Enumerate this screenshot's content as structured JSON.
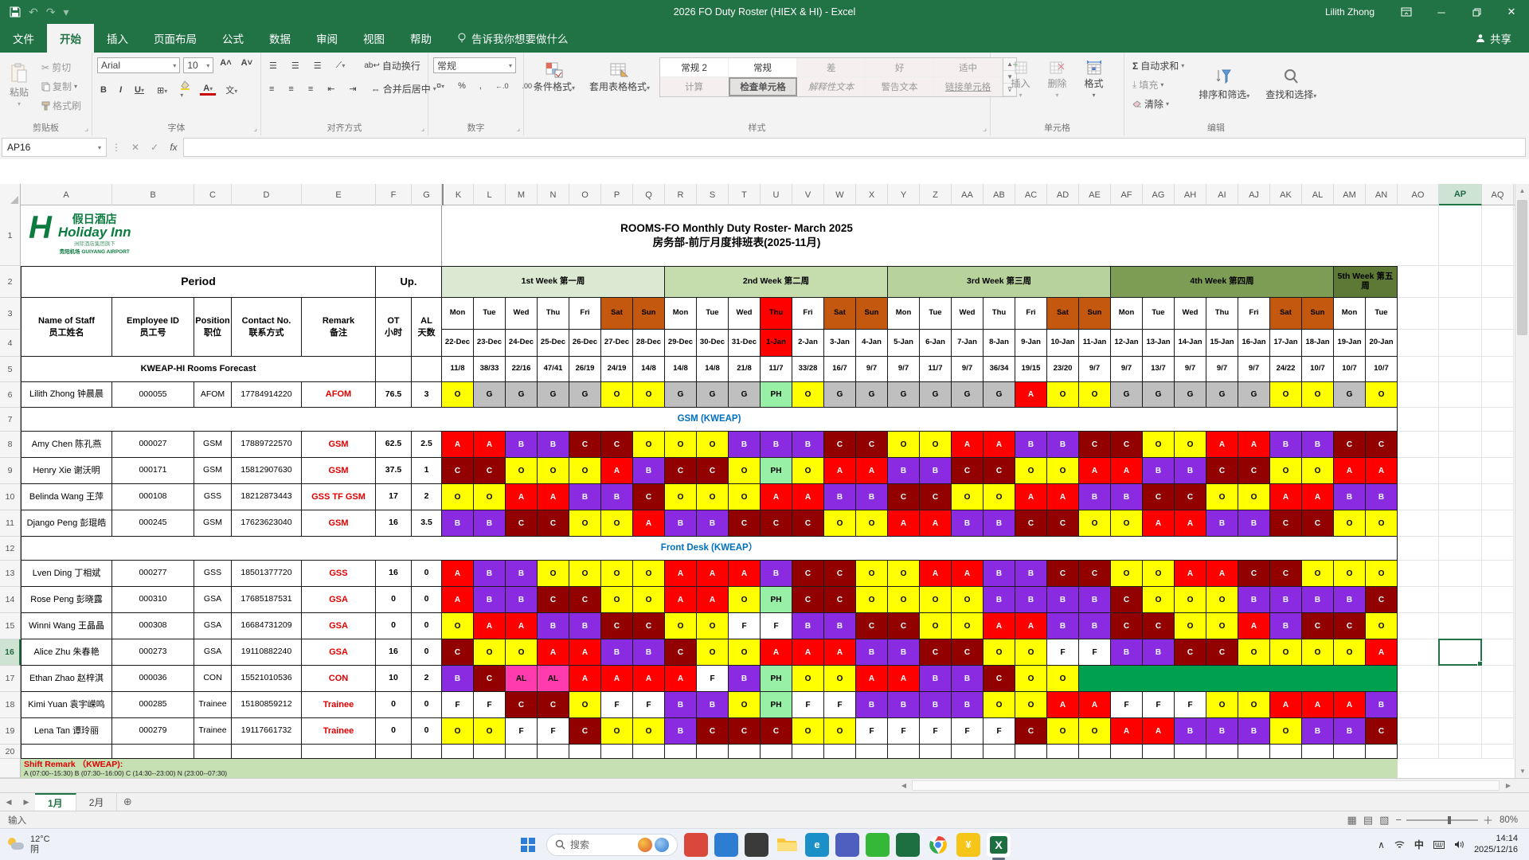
{
  "titlebar": {
    "title": "2026 FO Duty Roster (HIEX & HI)  -  Excel",
    "user": "Lilith Zhong"
  },
  "menu": {
    "tabs": [
      "文件",
      "开始",
      "插入",
      "页面布局",
      "公式",
      "数据",
      "审阅",
      "视图",
      "帮助"
    ],
    "active_tab": "开始",
    "tellme": "告诉我你想要做什么",
    "share": "共享"
  },
  "ribbon": {
    "clipboard": {
      "paste": "粘贴",
      "cut": "剪切",
      "copy": "复制",
      "painter": "格式刷",
      "label": "剪贴板"
    },
    "font": {
      "family": "Arial",
      "size": "10",
      "label": "字体",
      "pinyin": "文"
    },
    "align": {
      "wrap": "自动换行",
      "merge": "合并后居中",
      "label": "对齐方式"
    },
    "number": {
      "format": "常规",
      "label": "数字"
    },
    "styles": {
      "cond": "条件格式",
      "table": "套用表格格式",
      "label": "样式",
      "gallery": [
        "常规 2",
        "常规",
        "差",
        "好",
        "适中",
        "计算",
        "检查单元格",
        "解释性文本",
        "警告文本",
        "链接单元格"
      ],
      "selected_style": "检查单元格"
    },
    "cells": {
      "insert": "插入",
      "delete": "删除",
      "format": "格式",
      "label": "单元格"
    },
    "editing": {
      "autosum": "自动求和",
      "fill": "填充",
      "clear": "清除",
      "sort": "排序和筛选",
      "find": "查找和选择",
      "label": "编辑"
    }
  },
  "formula_bar": {
    "name_box": "AP16",
    "fx": "fx"
  },
  "sheet": {
    "col_headers": [
      "A",
      "B",
      "C",
      "D",
      "E",
      "F",
      "G",
      "K",
      "L",
      "M",
      "N",
      "O",
      "P",
      "Q",
      "R",
      "S",
      "T",
      "U",
      "V",
      "W",
      "X",
      "Y",
      "Z",
      "AA",
      "AB",
      "AC",
      "AD",
      "AE",
      "AF",
      "AG",
      "AH",
      "AI",
      "AJ",
      "AK",
      "AL",
      "AM",
      "AN",
      "AO",
      "AP",
      "AQ"
    ],
    "selected_col": "AP",
    "selected_row": 16,
    "logo": {
      "cn": "假日酒店",
      "en": "Holiday Inn",
      "sub1": "洲际酒店集团旗下",
      "sub2": "贵阳机场 GUIYANG AIRPORT"
    },
    "title1": "ROOMS-FO Monthly Duty Roster- March 2025",
    "title2": "房务部-前厅月度排班表(2025-11月)",
    "period": "Period",
    "up": "Up.",
    "left_headers": [
      [
        "Name of Staff",
        "员工姓名"
      ],
      [
        "Employee ID",
        "员工号"
      ],
      [
        "Position",
        "职位"
      ],
      [
        "Contact No.",
        "联系方式"
      ],
      [
        "Remark",
        "备注"
      ]
    ],
    "ot": [
      "OT",
      "小时"
    ],
    "al": [
      "AL",
      "天数"
    ],
    "weeks": [
      {
        "label": "1st Week 第一周",
        "days": 7,
        "color": "#dce9d2"
      },
      {
        "label": "2nd Week 第二周",
        "days": 7,
        "color": "#c5dcad"
      },
      {
        "label": "3rd Week 第三周",
        "days": 7,
        "color": "#b7d29b"
      },
      {
        "label": "4th Week 第四周",
        "days": 7,
        "color": "#7d9d54"
      },
      {
        "label": "5th Week 第五周",
        "days": 2,
        "color": "#5d7935"
      }
    ],
    "days": [
      "Mon",
      "Tue",
      "Wed",
      "Thu",
      "Fri",
      "Sat",
      "Sun",
      "Mon",
      "Tue",
      "Wed",
      "Thu",
      "Fri",
      "Sat",
      "Sun",
      "Mon",
      "Tue",
      "Wed",
      "Thu",
      "Fri",
      "Sat",
      "Sun",
      "Mon",
      "Tue",
      "Wed",
      "Thu",
      "Fri",
      "Sat",
      "Sun",
      "Mon",
      "Tue"
    ],
    "weekend_idx": [
      5,
      6,
      12,
      13,
      19,
      20,
      26,
      27
    ],
    "holiday_idx": 10,
    "dates": [
      "22-Dec",
      "23-Dec",
      "24-Dec",
      "25-Dec",
      "26-Dec",
      "27-Dec",
      "28-Dec",
      "29-Dec",
      "30-Dec",
      "31-Dec",
      "1-Jan",
      "2-Jan",
      "3-Jan",
      "4-Jan",
      "5-Jan",
      "6-Jan",
      "7-Jan",
      "8-Jan",
      "9-Jan",
      "10-Jan",
      "11-Jan",
      "12-Jan",
      "13-Jan",
      "14-Jan",
      "15-Jan",
      "16-Jan",
      "17-Jan",
      "18-Jan",
      "19-Jan",
      "20-Jan"
    ],
    "forecast_label": "KWEAP-HI Rooms Forecast",
    "forecast": [
      "11/8",
      "38/33",
      "22/16",
      "47/41",
      "26/19",
      "24/19",
      "14/8",
      "14/8",
      "14/8",
      "21/8",
      "11/7",
      "33/28",
      "16/7",
      "9/7",
      "9/7",
      "11/7",
      "9/7",
      "36/34",
      "19/15",
      "23/20",
      "9/7",
      "9/7",
      "13/7",
      "9/7",
      "9/7",
      "9/7",
      "24/22",
      "10/7",
      "10/7",
      "10/7"
    ],
    "group1": "GSM (KWEAP)",
    "group2": "Front Desk (KWEAP）",
    "staff": [
      {
        "row": 6,
        "name": "Lilith Zhong 钟晨晨",
        "id": "000055",
        "position": "AFOM",
        "contact": "17784914220",
        "remark": "AFOM",
        "ot": "76.5",
        "al": "3",
        "shifts": [
          "O",
          "G",
          "G",
          "G",
          "G",
          "O",
          "O",
          "G",
          "G",
          "G",
          "PH",
          "O",
          "G",
          "G",
          "G",
          "G",
          "G",
          "G",
          "A",
          "O",
          "O",
          "G",
          "G",
          "G",
          "G",
          "G",
          "O",
          "O",
          "G",
          "O"
        ]
      },
      {
        "row": 8,
        "name": "Amy Chen 陈孔燕",
        "id": "000027",
        "position": "GSM",
        "contact": "17889722570",
        "remark": "GSM",
        "ot": "62.5",
        "al": "2.5",
        "shifts": [
          "A",
          "A",
          "B",
          "B",
          "C",
          "C",
          "O",
          "O",
          "O",
          "B",
          "B",
          "B",
          "C",
          "C",
          "O",
          "O",
          "A",
          "A",
          "B",
          "B",
          "C",
          "C",
          "O",
          "O",
          "A",
          "A",
          "B",
          "B",
          "C",
          "C"
        ]
      },
      {
        "row": 9,
        "name": "Henry Xie 谢沃明",
        "id": "000171",
        "position": "GSM",
        "contact": "15812907630",
        "remark": "GSM",
        "ot": "37.5",
        "al": "1",
        "shifts": [
          "C",
          "C",
          "O",
          "O",
          "O",
          "A",
          "B",
          "C",
          "C",
          "O",
          "PH",
          "O",
          "A",
          "A",
          "B",
          "B",
          "C",
          "C",
          "O",
          "O",
          "A",
          "A",
          "B",
          "B",
          "C",
          "C",
          "O",
          "O",
          "A",
          "A"
        ]
      },
      {
        "row": 10,
        "name": "Belinda Wang 王萍",
        "id": "000108",
        "position": "GSS",
        "contact": "18212873443",
        "remark": "GSS TF GSM",
        "ot": "17",
        "al": "2",
        "shifts": [
          "O",
          "O",
          "A",
          "A",
          "B",
          "B",
          "C",
          "O",
          "O",
          "O",
          "A",
          "A",
          "B",
          "B",
          "C",
          "C",
          "O",
          "O",
          "A",
          "A",
          "B",
          "B",
          "C",
          "C",
          "O",
          "O",
          "A",
          "A",
          "B",
          "B"
        ]
      },
      {
        "row": 11,
        "name": "Django Peng 彭琨皓",
        "id": "000245",
        "position": "GSM",
        "contact": "17623623040",
        "remark": "GSM",
        "ot": "16",
        "al": "3.5",
        "shifts": [
          "B",
          "B",
          "C",
          "C",
          "O",
          "O",
          "A",
          "B",
          "B",
          "C",
          "C",
          "C",
          "O",
          "O",
          "A",
          "A",
          "B",
          "B",
          "C",
          "C",
          "O",
          "O",
          "A",
          "A",
          "B",
          "B",
          "C",
          "C",
          "O",
          "O"
        ]
      },
      {
        "row": 13,
        "name": "Lven Ding 丁相斌",
        "id": "000277",
        "position": "GSS",
        "contact": "18501377720",
        "remark": "GSS",
        "ot": "16",
        "al": "0",
        "shifts": [
          "A",
          "B",
          "B",
          "O",
          "O",
          "O",
          "O",
          "A",
          "A",
          "A",
          "B",
          "C",
          "C",
          "O",
          "O",
          "A",
          "A",
          "B",
          "B",
          "C",
          "C",
          "O",
          "O",
          "A",
          "A",
          "C",
          "C",
          "O",
          "O",
          "O"
        ]
      },
      {
        "row": 14,
        "name": "Rose Peng 彭晓露",
        "id": "000310",
        "position": "GSA",
        "contact": "17685187531",
        "remark": "GSA",
        "ot": "0",
        "al": "0",
        "shifts": [
          "A",
          "B",
          "B",
          "C",
          "C",
          "O",
          "O",
          "A",
          "A",
          "O",
          "PH",
          "C",
          "C",
          "O",
          "O",
          "O",
          "O",
          "B",
          "B",
          "B",
          "B",
          "C",
          "O",
          "O",
          "O",
          "B",
          "B",
          "B",
          "B",
          "C"
        ]
      },
      {
        "row": 15,
        "name": "Winni Wang 王晶晶",
        "id": "000308",
        "position": "GSA",
        "contact": "16684731209",
        "remark": "GSA",
        "ot": "0",
        "al": "0",
        "shifts": [
          "O",
          "A",
          "A",
          "B",
          "B",
          "C",
          "C",
          "O",
          "O",
          "F",
          "F",
          "B",
          "B",
          "C",
          "C",
          "O",
          "O",
          "A",
          "A",
          "B",
          "B",
          "C",
          "C",
          "O",
          "O",
          "A",
          "B",
          "C",
          "C",
          "O"
        ]
      },
      {
        "row": 16,
        "name": "Alice Zhu 朱春艳",
        "id": "000273",
        "position": "GSA",
        "contact": "19110882240",
        "remark": "GSA",
        "ot": "16",
        "al": "0",
        "shifts": [
          "C",
          "O",
          "O",
          "A",
          "A",
          "B",
          "B",
          "C",
          "O",
          "O",
          "A",
          "A",
          "A",
          "B",
          "B",
          "C",
          "C",
          "O",
          "O",
          "F",
          "F",
          "B",
          "B",
          "C",
          "C",
          "O",
          "O",
          "O",
          "O",
          "A"
        ]
      },
      {
        "row": 17,
        "name": "Ethan Zhao 赵梓淇",
        "id": "000036",
        "position": "CON",
        "contact": "15521010536",
        "remark": "CON",
        "ot": "10",
        "al": "2",
        "shifts": [
          "B",
          "C",
          "AL",
          "AL",
          "A",
          "A",
          "A",
          "A",
          "F",
          "B",
          "PH",
          "O",
          "O",
          "A",
          "A",
          "B",
          "B",
          "C",
          "O",
          "O"
        ],
        "band_span": 10
      },
      {
        "row": 18,
        "name": "Kimi Yuan 袁宇嵘鸣",
        "id": "000285",
        "position": "Trainee",
        "contact": "15180859212",
        "remark": "Trainee",
        "ot": "0",
        "al": "0",
        "shifts": [
          "F",
          "F",
          "C",
          "C",
          "O",
          "F",
          "F",
          "B",
          "B",
          "O",
          "PH",
          "F",
          "F",
          "B",
          "B",
          "B",
          "B",
          "O",
          "O",
          "A",
          "A",
          "F",
          "F",
          "F",
          "O",
          "O",
          "A",
          "A",
          "A",
          "B"
        ]
      },
      {
        "row": 19,
        "name": "Lena Tan 谭玲丽",
        "id": "000279",
        "position": "Trainee",
        "contact": "19117661732",
        "remark": "Trainee",
        "ot": "0",
        "al": "0",
        "shifts": [
          "O",
          "O",
          "F",
          "F",
          "C",
          "O",
          "O",
          "B",
          "C",
          "C",
          "C",
          "O",
          "O",
          "F",
          "F",
          "F",
          "F",
          "F",
          "C",
          "O",
          "O",
          "A",
          "A",
          "B",
          "B",
          "B",
          "O",
          "B",
          "B",
          "C"
        ]
      }
    ],
    "shift_palette": {
      "A": {
        "bg": "#ff0000",
        "fg": "#ffffff"
      },
      "B": {
        "bg": "#8a2be2",
        "fg": "#ffffff"
      },
      "C": {
        "bg": "#930000",
        "fg": "#ffffff"
      },
      "O": {
        "bg": "#ffff00",
        "fg": "#000000"
      },
      "G": {
        "bg": "#bfbfbf",
        "fg": "#000000"
      },
      "PH": {
        "bg": "#98efa6",
        "fg": "#000000"
      },
      "F": {
        "bg": "#ffffff",
        "fg": "#000000"
      },
      "AL": {
        "bg": "#ff3bae",
        "fg": "#000000"
      }
    },
    "colors": {
      "accent": "#217346",
      "weekend_bg": "#c4580f",
      "holiday_bg": "#ff0000",
      "band_bg": "#c6e0b4",
      "ethan_band": "#00a14e"
    },
    "remark_label": "Shift Remark （KWEAP):",
    "remark_line": "A (07:00--15:30)    B (07:30--16:00)    C (14:30--23:00)    N (23:00--07:30)"
  },
  "tabs_row": {
    "tabs": [
      "1月",
      "2月"
    ],
    "active": "1月"
  },
  "status_bar": {
    "mode": "输入",
    "zoom": "80%"
  },
  "taskbar": {
    "weather_temp": "12°C",
    "weather_cond": "阴",
    "search": "搜索",
    "ime": "中",
    "time": "14:14",
    "date": "2025/12/16",
    "apps": [
      {
        "name": "people-app-icon",
        "color": "#d9483b",
        "glyph": ""
      },
      {
        "name": "contacts-app-icon",
        "color": "#2d7dd2",
        "glyph": ""
      },
      {
        "name": "terminal-app-icon",
        "color": "#3a3a3a",
        "glyph": ""
      },
      {
        "name": "file-explorer-icon",
        "color": "#f8c73c",
        "glyph": ""
      },
      {
        "name": "edge-browser-icon",
        "color": "#1b90c8",
        "glyph": "e"
      },
      {
        "name": "teams-app-icon",
        "color": "#4e5fbf",
        "glyph": ""
      },
      {
        "name": "wechat-app-icon",
        "color": "#35b837",
        "glyph": ""
      },
      {
        "name": "mail-app-icon",
        "color": "#1d6f42",
        "glyph": ""
      },
      {
        "name": "chrome-browser-icon",
        "color": "#ea4335",
        "glyph": ""
      },
      {
        "name": "stock-app-icon",
        "color": "#f5c518",
        "glyph": "¥"
      },
      {
        "name": "excel-app-icon",
        "color": "#1d6f42",
        "glyph": "X",
        "active": true
      }
    ]
  }
}
